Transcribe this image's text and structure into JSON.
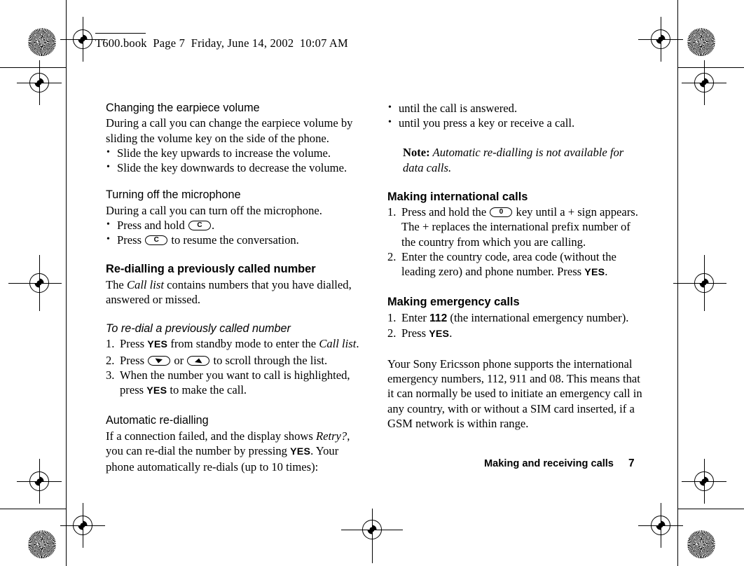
{
  "running_head": "T600.book  Page 7  Friday, June 14, 2002  10:07 AM",
  "footer": {
    "section": "Making and receiving calls",
    "page_number": "7"
  },
  "keys": {
    "clear": "C",
    "zero": "0",
    "down_arrow": "down-arrow",
    "up_arrow": "up-arrow"
  },
  "left_column": {
    "earpiece": {
      "heading": "Changing the earpiece volume",
      "body": "During a call you can change the earpiece volume by sliding the volume key on the side of the phone.",
      "bullets": [
        "Slide the key upwards to increase the volume.",
        "Slide the key downwards to decrease the volume."
      ]
    },
    "microphone": {
      "heading": "Turning off the microphone",
      "body": "During a call you can turn off the microphone.",
      "bullet_1_pre": "Press and hold ",
      "bullet_1_post": ".",
      "bullet_2_pre": "Press ",
      "bullet_2_post": " to resume the conversation."
    },
    "redial": {
      "heading": "Re-dialling a previously called number",
      "body_pre": "The ",
      "body_italic": "Call list",
      "body_post": " contains numbers that you have dialled, answered or missed.",
      "sub_heading": "To re-dial a previously called number",
      "step1_a": "Press ",
      "step1_yes": "YES",
      "step1_b": " from standby mode to enter the ",
      "step1_italic": "Call list",
      "step1_c": ".",
      "step2_a": "Press ",
      "step2_b": " or ",
      "step2_c": " to scroll through the list.",
      "step3_a": "When the number you want to call is highlighted, press ",
      "step3_yes": "YES",
      "step3_b": " to make the call."
    },
    "auto_redial": {
      "heading": "Automatic re-dialling",
      "body_a": "If a connection failed, and the display shows ",
      "body_italic": "Retry?",
      "body_b": ", you can re-dial the number by pressing ",
      "body_yes": "YES",
      "body_c": ". Your phone automatically re-dials (up to 10 times):"
    }
  },
  "right_column": {
    "continued_bullets": [
      "until the call is answered.",
      "until you press a key or receive a call."
    ],
    "note": {
      "label": "Note:",
      "text": " Automatic re-dialling is not available for data calls."
    },
    "international": {
      "heading": "Making international calls",
      "step1_a": "Press and hold the ",
      "step1_b": " key until a + sign appears. The + replaces the international prefix number of the country from which you are calling.",
      "step2_a": "Enter the country code, area code (without the leading zero) and phone number. Press ",
      "step2_yes": "YES",
      "step2_b": "."
    },
    "emergency": {
      "heading": "Making emergency calls",
      "step1_a": "Enter ",
      "step1_num": "112",
      "step1_b": " (the international emergency number).",
      "step2_a": "Press ",
      "step2_yes": "YES",
      "step2_b": ".",
      "paragraph": "Your Sony Ericsson phone supports the international emergency numbers, 112, 911 and 08. This means that it can normally be used to initiate an emergency call in any country, with or without a SIM card inserted, if a GSM network is within range."
    }
  }
}
